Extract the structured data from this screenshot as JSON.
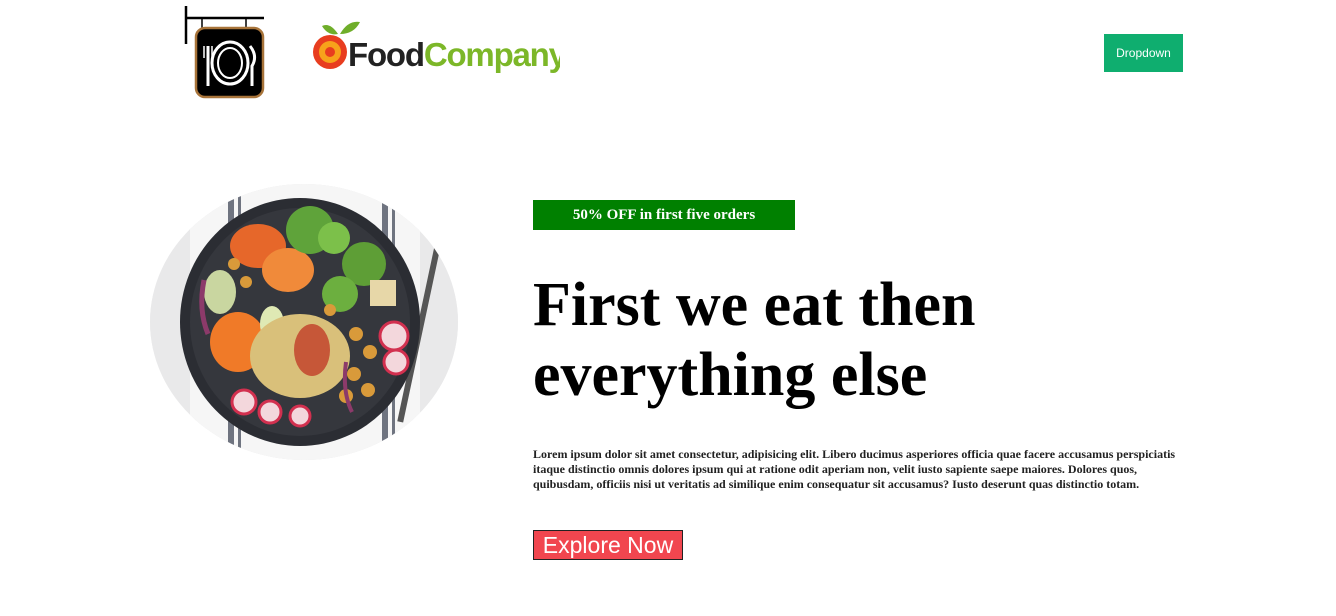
{
  "header": {
    "sign_logo_icon": "restaurant-sign-icon",
    "brand": {
      "part1": "Food",
      "part2": "Company",
      "color_food": "#222222",
      "color_company": "#7cb728"
    },
    "dropdown_label": "Dropdown"
  },
  "hero": {
    "image_icon": "food-bowl-image",
    "promo_badge": "50% OFF in first five orders",
    "title_line1": "First we eat then",
    "title_line2": "everything else",
    "paragraph": "Lorem ipsum dolor sit amet consectetur, adipisicing elit. Libero ducimus asperiores officia quae facere accusamus perspiciatis itaque distinctio omnis dolores ipsum qui at ratione odit aperiam non, velit iusto sapiente saepe maiores. Dolores quos, quibusdam, officiis nisi ut veritatis ad similique enim consequatur sit accusamus? Iusto deserunt quas distinctio totam.",
    "cta_label": "Explore Now"
  },
  "colors": {
    "dropdown_bg": "#0fae6f",
    "promo_bg": "#008000",
    "cta_bg": "#f1464f"
  }
}
